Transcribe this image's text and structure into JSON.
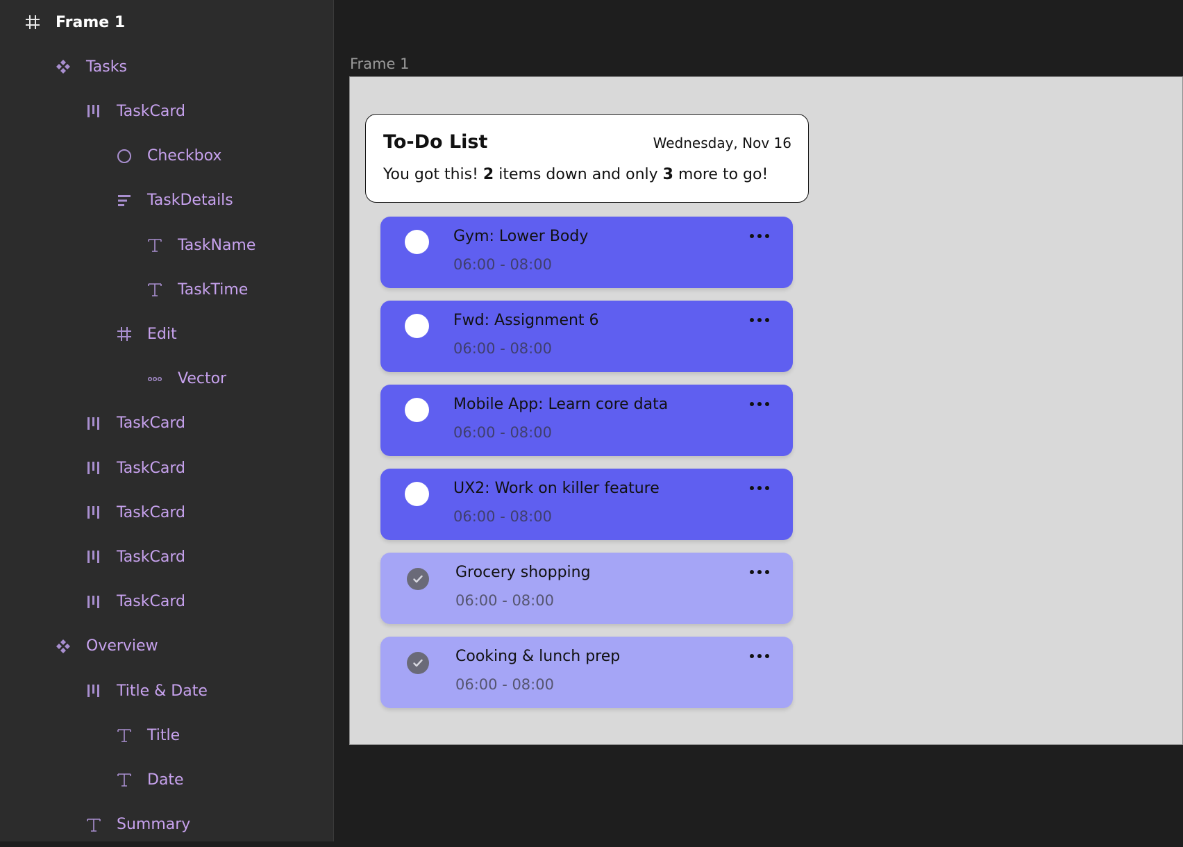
{
  "layers": [
    {
      "label": "Frame 1",
      "icon": "frame-icon",
      "depth": 0
    },
    {
      "label": "Tasks",
      "icon": "component-icon",
      "depth": 1
    },
    {
      "label": "TaskCard",
      "icon": "auto-layout-icon",
      "depth": 2
    },
    {
      "label": "Checkbox",
      "icon": "ellipse-icon",
      "depth": 3
    },
    {
      "label": "TaskDetails",
      "icon": "vertical-layout-icon",
      "depth": 3
    },
    {
      "label": "TaskName",
      "icon": "text-icon",
      "depth": 4
    },
    {
      "label": "TaskTime",
      "icon": "text-icon",
      "depth": 4
    },
    {
      "label": "Edit",
      "icon": "frame-icon",
      "depth": 3
    },
    {
      "label": "Vector",
      "icon": "vector-icon",
      "depth": 4
    },
    {
      "label": "TaskCard",
      "icon": "auto-layout-icon",
      "depth": 2
    },
    {
      "label": "TaskCard",
      "icon": "auto-layout-icon",
      "depth": 2
    },
    {
      "label": "TaskCard",
      "icon": "auto-layout-icon",
      "depth": 2
    },
    {
      "label": "TaskCard",
      "icon": "auto-layout-icon",
      "depth": 2
    },
    {
      "label": "TaskCard",
      "icon": "auto-layout-icon",
      "depth": 2
    },
    {
      "label": "Overview",
      "icon": "component-icon",
      "depth": 1
    },
    {
      "label": "Title & Date",
      "icon": "auto-layout-icon",
      "depth": 2
    },
    {
      "label": "Title",
      "icon": "text-icon",
      "depth": 3
    },
    {
      "label": "Date",
      "icon": "text-icon",
      "depth": 3
    },
    {
      "label": "Summary",
      "icon": "text-icon",
      "depth": 2
    }
  ],
  "canvas": {
    "frame_label": "Frame 1",
    "overview": {
      "title": "To-Do List",
      "date": "Wednesday, Nov 16",
      "summary_pre": "You got this! ",
      "summary_done": "2",
      "summary_mid": " items down and only ",
      "summary_left": "3",
      "summary_post": " more to go!"
    },
    "tasks": [
      {
        "name": "Gym: Lower Body",
        "time": "06:00 - 08:00",
        "done": false
      },
      {
        "name": "Fwd: Assignment 6",
        "time": "06:00 - 08:00",
        "done": false
      },
      {
        "name": "Mobile App: Learn core data",
        "time": "06:00 - 08:00",
        "done": false
      },
      {
        "name": "UX2: Work on killer feature",
        "time": "06:00 - 08:00",
        "done": false
      },
      {
        "name": "Grocery shopping",
        "time": "06:00 - 08:00",
        "done": true
      },
      {
        "name": "Cooking & lunch prep",
        "time": "06:00 - 08:00",
        "done": true
      }
    ]
  },
  "colors": {
    "panel_bg": "#2c2c2c",
    "layer_text": "#c7a2ee",
    "active_card": "#5f5ff0",
    "done_card": "#a5a5f6",
    "frame_bg": "#d9d9d9"
  }
}
